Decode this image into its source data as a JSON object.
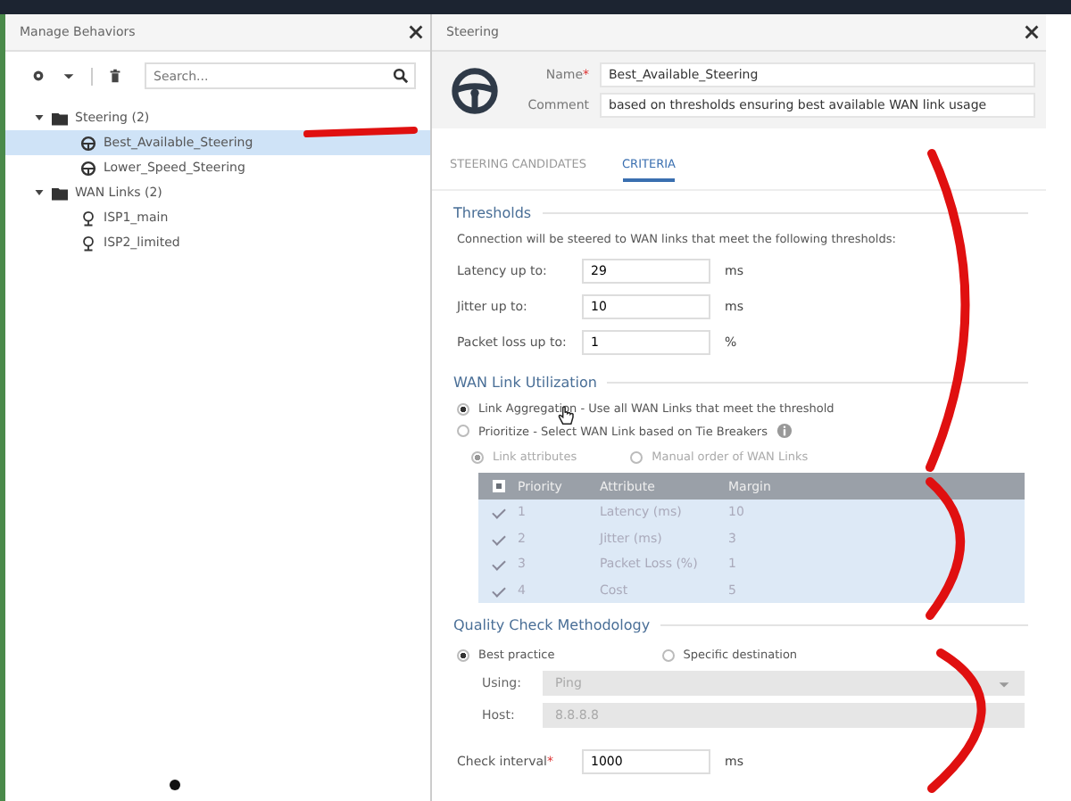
{
  "left_panel": {
    "title": "Manage Behaviors",
    "search": {
      "placeholder": "Search..."
    },
    "tree": [
      {
        "label": "Steering (2)",
        "kind": "folder",
        "expanded": true,
        "children": [
          {
            "label": "Best_Available_Steering",
            "kind": "steering",
            "selected": true
          },
          {
            "label": "Lower_Speed_Steering",
            "kind": "steering",
            "selected": false
          }
        ]
      },
      {
        "label": "WAN Links (2)",
        "kind": "folder",
        "expanded": true,
        "children": [
          {
            "label": "ISP1_main",
            "kind": "link",
            "selected": false
          },
          {
            "label": "ISP2_limited",
            "kind": "link",
            "selected": false
          }
        ]
      }
    ]
  },
  "editor": {
    "title": "Steering",
    "fields": [
      {
        "label": "Name",
        "required_mark": "*",
        "value": "Best_Available_Steering"
      },
      {
        "label": "Comment",
        "value": "based on thresholds ensuring best available WAN link usage"
      }
    ],
    "tabs": [
      {
        "label": "STEERING CANDIDATES",
        "selected": false
      },
      {
        "label": "CRITERIA",
        "selected": true
      }
    ],
    "thresholds": {
      "heading": "Thresholds",
      "description": "Connection will be steered to WAN links that meet the following thresholds:",
      "rows": [
        {
          "label": "Latency up to:",
          "value": "29",
          "unit": "ms"
        },
        {
          "label": "Jitter up to:",
          "value": "10",
          "unit": "ms"
        },
        {
          "label": "Packet loss up to:",
          "value": "1",
          "unit": "%"
        }
      ]
    },
    "utilization": {
      "heading": "WAN Link Utilization",
      "options": [
        {
          "label": "Link Aggregation - Use all WAN Links that meet the threshold",
          "selected": true,
          "info": false
        },
        {
          "label": "Prioritize - Select WAN Link based on Tie Breakers",
          "selected": false,
          "info": true
        }
      ],
      "sub_options": [
        {
          "label": "Link attributes",
          "selected": true
        },
        {
          "label": "Manual order of WAN Links",
          "selected": false
        }
      ],
      "table": {
        "header_checked": true,
        "columns": [
          "Priority",
          "Attribute",
          "Margin"
        ],
        "rows": [
          {
            "checked": true,
            "cells": [
              "1",
              "Latency (ms)",
              "10"
            ]
          },
          {
            "checked": true,
            "cells": [
              "2",
              "Jitter (ms)",
              "3"
            ]
          },
          {
            "checked": true,
            "cells": [
              "3",
              "Packet Loss (%)",
              "1"
            ]
          },
          {
            "checked": true,
            "cells": [
              "4",
              "Cost",
              "5"
            ]
          }
        ]
      }
    },
    "quality": {
      "heading": "Quality Check Methodology",
      "options": [
        {
          "label": "Best practice",
          "selected": true
        },
        {
          "label": "Specific destination",
          "selected": false
        }
      ],
      "using": {
        "label": "Using:",
        "value": "Ping",
        "disabled": true
      },
      "host": {
        "label": "Host:",
        "value": "8.8.8.8",
        "disabled": true
      },
      "interval": {
        "label": "Check interval",
        "required_mark": "*",
        "value": "1000",
        "unit": "ms"
      }
    }
  }
}
